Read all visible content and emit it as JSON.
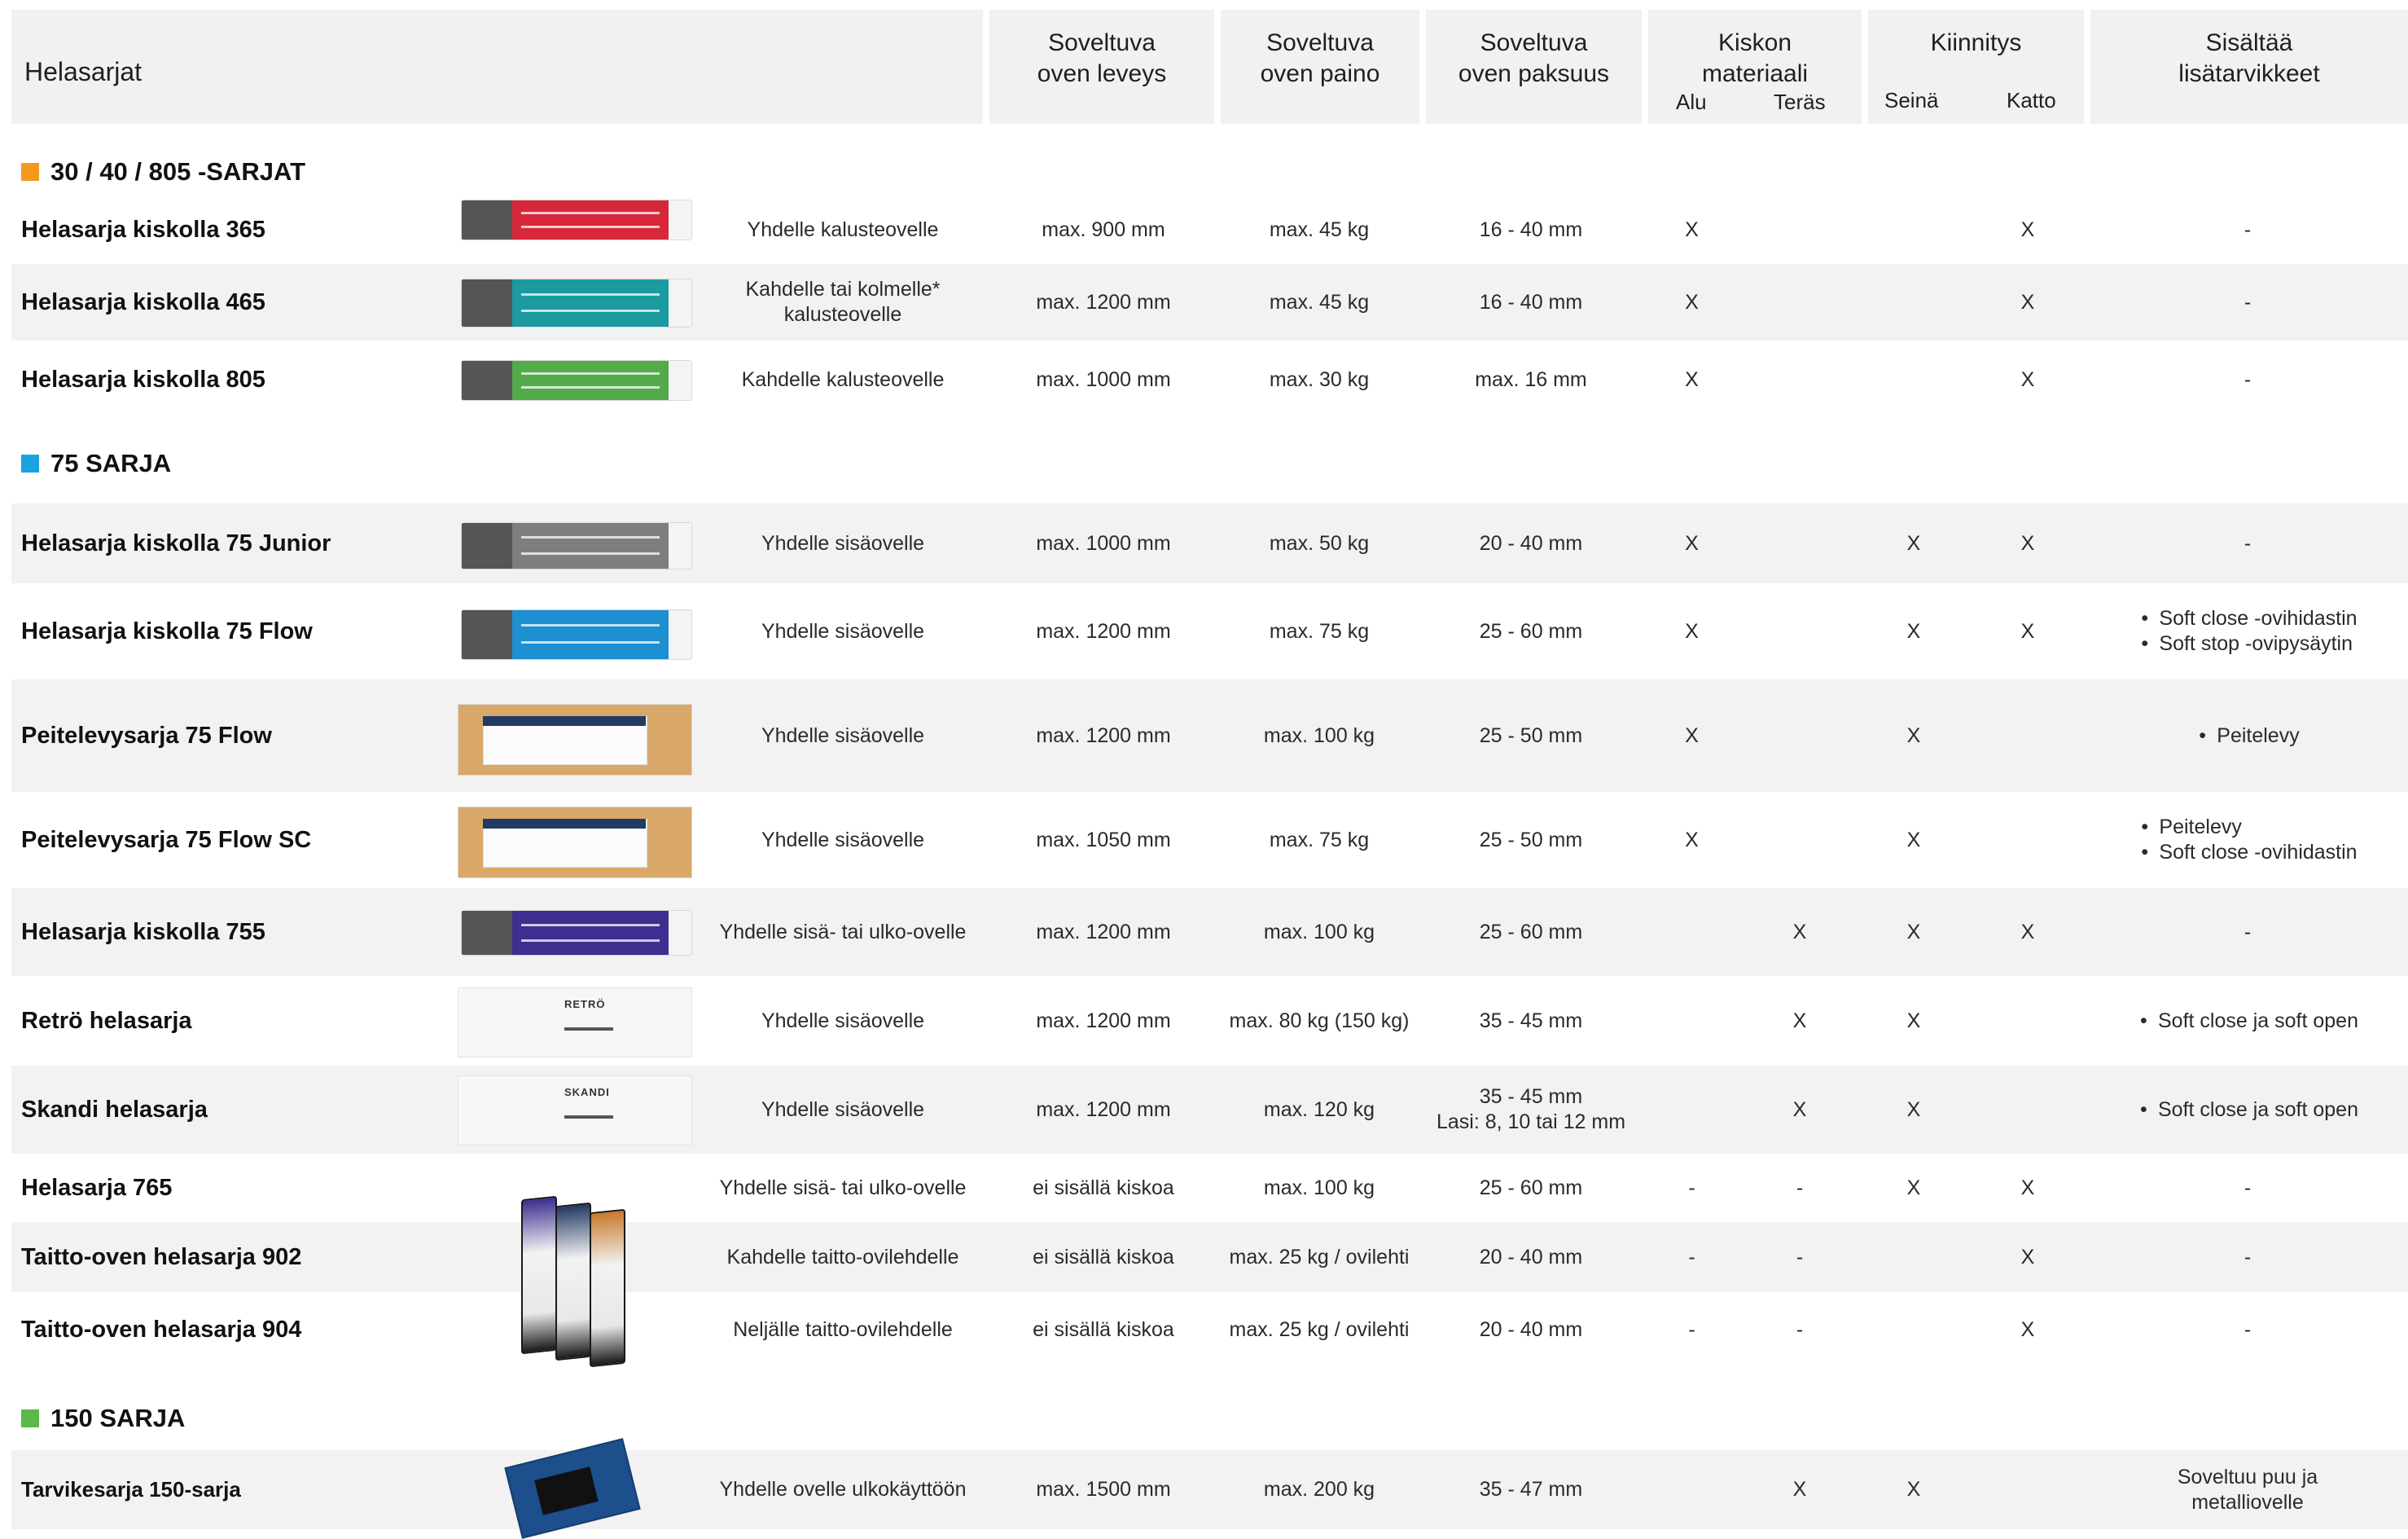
{
  "header": {
    "col_series": "Helasarjat",
    "col_width": [
      "Soveltuva",
      "oven leveys"
    ],
    "col_weight": [
      "Soveltuva",
      "oven paino"
    ],
    "col_thickness": [
      "Soveltuva",
      "oven paksuus"
    ],
    "col_material": [
      "Kiskon",
      "materiaali"
    ],
    "col_material_sub": [
      "Alu",
      "Teräs"
    ],
    "col_mount": "Kiinnitys",
    "col_mount_sub": [
      "Seinä",
      "Katto"
    ],
    "col_extras": [
      "Sisältää",
      "lisätarvikkeet"
    ]
  },
  "sections": [
    {
      "title": "30 / 40 / 805 -SARJAT",
      "color": "#f39a1e"
    },
    {
      "title": "75 SARJA",
      "color": "#1aa3e0"
    },
    {
      "title": "150 SARJA",
      "color": "#5cb848"
    }
  ],
  "rows": [
    {
      "name": "Helasarja kiskolla 365",
      "use": [
        "Yhdelle kalusteovelle"
      ],
      "width": "max. 900 mm",
      "weight": "max. 45 kg",
      "thickness": [
        "16 - 40 mm"
      ],
      "alu": "X",
      "steel": "",
      "wall": "",
      "ceiling": "X",
      "extras": [
        "-"
      ],
      "extras_list": false
    },
    {
      "name": "Helasarja kiskolla 465",
      "use": [
        "Kahdelle tai kolmelle*",
        "kalusteovelle"
      ],
      "width": "max. 1200 mm",
      "weight": "max. 45 kg",
      "thickness": [
        "16 - 40 mm"
      ],
      "alu": "X",
      "steel": "",
      "wall": "",
      "ceiling": "X",
      "extras": [
        "-"
      ],
      "extras_list": false
    },
    {
      "name": "Helasarja kiskolla 805",
      "use": [
        "Kahdelle kalusteovelle"
      ],
      "width": "max. 1000 mm",
      "weight": "max. 30 kg",
      "thickness": [
        "max. 16 mm"
      ],
      "alu": "X",
      "steel": "",
      "wall": "",
      "ceiling": "X",
      "extras": [
        "-"
      ],
      "extras_list": false
    },
    {
      "name": "Helasarja kiskolla 75 Junior",
      "use": [
        "Yhdelle sisäovelle"
      ],
      "width": "max. 1000 mm",
      "weight": "max. 50 kg",
      "thickness": [
        "20 - 40 mm"
      ],
      "alu": "X",
      "steel": "",
      "wall": "X",
      "ceiling": "X",
      "extras": [
        "-"
      ],
      "extras_list": false
    },
    {
      "name": "Helasarja kiskolla 75 Flow",
      "use": [
        "Yhdelle sisäovelle"
      ],
      "width": "max. 1200 mm",
      "weight": "max. 75 kg",
      "thickness": [
        "25 - 60 mm"
      ],
      "alu": "X",
      "steel": "",
      "wall": "X",
      "ceiling": "X",
      "extras": [
        "Soft close -ovihidastin",
        "Soft stop -ovipysäytin"
      ],
      "extras_list": true
    },
    {
      "name": "Peitelevysarja 75 Flow",
      "use": [
        "Yhdelle sisäovelle"
      ],
      "width": "max. 1200 mm",
      "weight": "max. 100 kg",
      "thickness": [
        "25 - 50 mm"
      ],
      "alu": "X",
      "steel": "",
      "wall": "X",
      "ceiling": "",
      "extras": [
        "Peitelevy"
      ],
      "extras_list": true
    },
    {
      "name": "Peitelevysarja 75 Flow SC",
      "use": [
        "Yhdelle sisäovelle"
      ],
      "width": "max. 1050 mm",
      "weight": "max. 75 kg",
      "thickness": [
        "25 - 50 mm"
      ],
      "alu": "X",
      "steel": "",
      "wall": "X",
      "ceiling": "",
      "extras": [
        "Peitelevy",
        "Soft close -ovihidastin"
      ],
      "extras_list": true
    },
    {
      "name": "Helasarja kiskolla 755",
      "use": [
        "Yhdelle sisä- tai ulko-ovelle"
      ],
      "width": "max. 1200 mm",
      "weight": "max. 100 kg",
      "thickness": [
        "25 - 60 mm"
      ],
      "alu": "",
      "steel": "X",
      "wall": "X",
      "ceiling": "X",
      "extras": [
        "-"
      ],
      "extras_list": false
    },
    {
      "name": "Retrö helasarja",
      "use": [
        "Yhdelle sisäovelle"
      ],
      "width": "max. 1200 mm",
      "weight": "max. 80 kg (150 kg)",
      "thickness": [
        "35 - 45 mm"
      ],
      "alu": "",
      "steel": "X",
      "wall": "X",
      "ceiling": "",
      "extras": [
        "Soft close ja soft open"
      ],
      "extras_list": true
    },
    {
      "name": "Skandi helasarja",
      "use": [
        "Yhdelle sisäovelle"
      ],
      "width": "max. 1200 mm",
      "weight": "max. 120 kg",
      "thickness": [
        "35 - 45 mm",
        "Lasi: 8, 10 tai 12 mm"
      ],
      "alu": "",
      "steel": "X",
      "wall": "X",
      "ceiling": "",
      "extras": [
        "Soft close ja soft open"
      ],
      "extras_list": true
    },
    {
      "name": "Helasarja 765",
      "use": [
        "Yhdelle sisä- tai ulko-ovelle"
      ],
      "width": "ei sisällä kiskoa",
      "weight": "max. 100 kg",
      "thickness": [
        "25 - 60 mm"
      ],
      "alu": "-",
      "steel": "-",
      "wall": "X",
      "ceiling": "X",
      "extras": [
        "-"
      ],
      "extras_list": false
    },
    {
      "name": "Taitto-oven helasarja 902",
      "use": [
        "Kahdelle taitto-ovilehdelle"
      ],
      "width": "ei sisällä kiskoa",
      "weight": "max. 25 kg / ovilehti",
      "thickness": [
        "20 - 40 mm"
      ],
      "alu": "-",
      "steel": "-",
      "wall": "",
      "ceiling": "X",
      "extras": [
        "-"
      ],
      "extras_list": false
    },
    {
      "name": "Taitto-oven helasarja 904",
      "use": [
        "Neljälle taitto-ovilehdelle"
      ],
      "width": "ei sisällä kiskoa",
      "weight": "max. 25 kg / ovilehti",
      "thickness": [
        "20 - 40 mm"
      ],
      "alu": "-",
      "steel": "-",
      "wall": "",
      "ceiling": "X",
      "extras": [
        "-"
      ],
      "extras_list": false
    },
    {
      "name": "Tarvikesarja 150-sarja",
      "use": [
        "Yhdelle ovelle ulkokäyttöön"
      ],
      "width": "max. 1500 mm",
      "weight": "max. 200 kg",
      "thickness": [
        "35 - 47 mm"
      ],
      "alu": "",
      "steel": "X",
      "wall": "X",
      "ceiling": "",
      "extras": [
        "Soveltuu puu ja",
        "metalliovelle"
      ],
      "extras_list": false
    }
  ],
  "package_labels": {
    "retro": "RETRÖ",
    "skandi": "SKANDI"
  },
  "package_colors": {
    "red": "#d6283a",
    "teal": "#1b9aa0",
    "green": "#54a948",
    "grey": "#7e7e7e",
    "blue": "#1e8fd0",
    "purple": "#3d2f8f",
    "cardboard": "#d9a868",
    "brand_navy": "#233a63"
  }
}
